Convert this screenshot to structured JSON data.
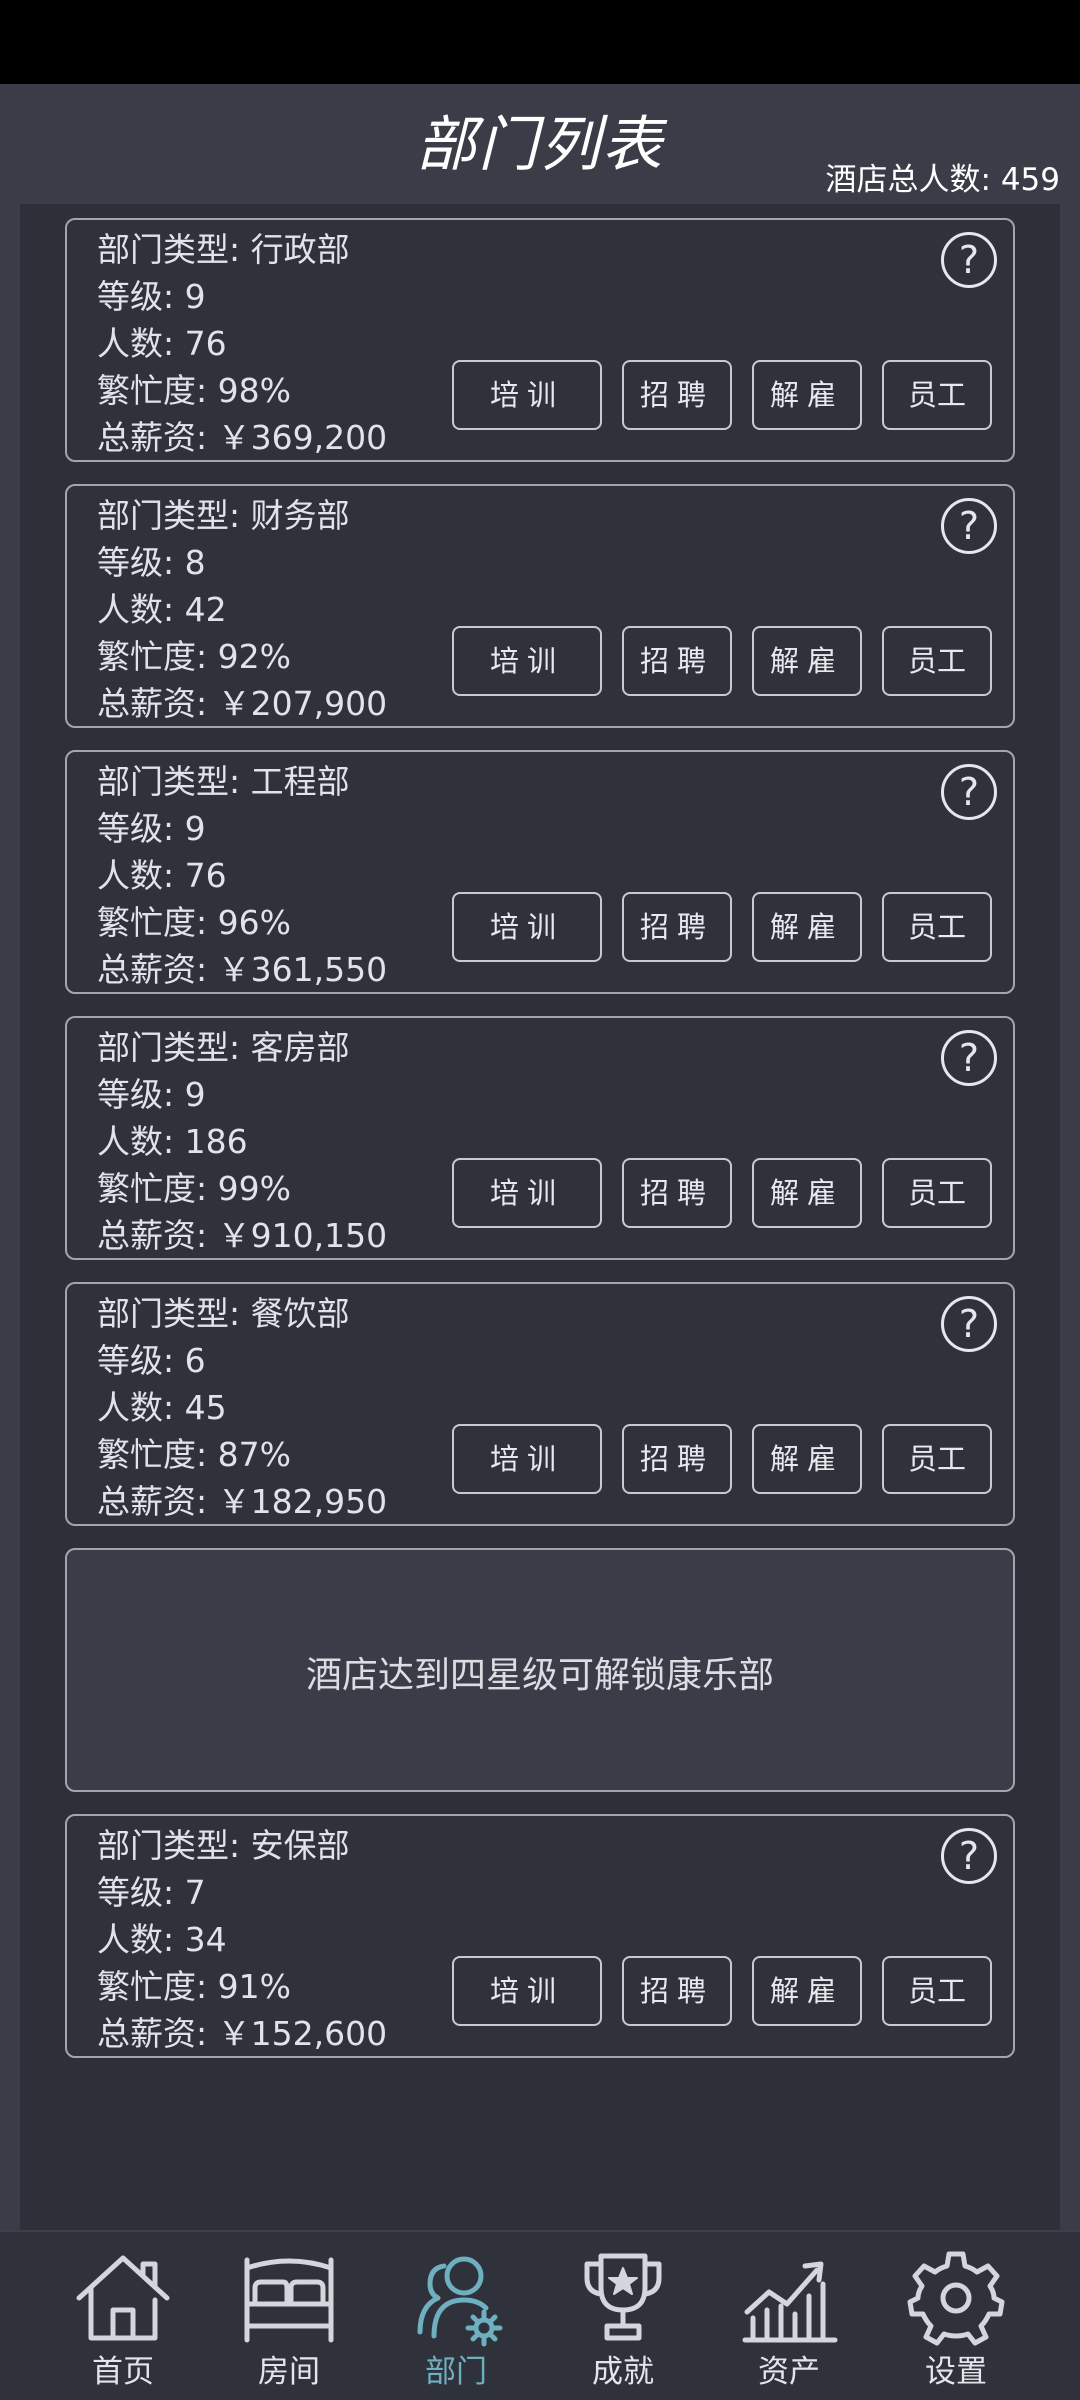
{
  "header": {
    "title": "部门列表",
    "total_staff": "酒店总人数: 459"
  },
  "departments": [
    {
      "type": "部门类型: 行政部",
      "level": "等级: 9",
      "count": "人数: 76",
      "busy": "繁忙度: 98%",
      "salary": "总薪资: ￥369,200"
    },
    {
      "type": "部门类型: 财务部",
      "level": "等级: 8",
      "count": "人数: 42",
      "busy": "繁忙度: 92%",
      "salary": "总薪资: ￥207,900"
    },
    {
      "type": "部门类型: 工程部",
      "level": "等级: 9",
      "count": "人数: 76",
      "busy": "繁忙度: 96%",
      "salary": "总薪资: ￥361,550"
    },
    {
      "type": "部门类型: 客房部",
      "level": "等级: 9",
      "count": "人数: 186",
      "busy": "繁忙度: 99%",
      "salary": "总薪资: ￥910,150"
    },
    {
      "type": "部门类型: 餐饮部",
      "level": "等级: 6",
      "count": "人数: 45",
      "busy": "繁忙度: 87%",
      "salary": "总薪资: ￥182,950"
    },
    {
      "type": "部门类型: 安保部",
      "level": "等级: 7",
      "count": "人数: 34",
      "busy": "繁忙度: 91%",
      "salary": "总薪资: ￥152,600"
    }
  ],
  "locked": {
    "text": "酒店达到四星级可解锁康乐部"
  },
  "buttons": {
    "help": "?",
    "train": "培训",
    "hire": "招聘",
    "fire": "解雇",
    "staff": "员工"
  },
  "nav": {
    "active_color": "#6fb0c0",
    "items": [
      {
        "label": "首页",
        "icon": "home-icon"
      },
      {
        "label": "房间",
        "icon": "bed-icon"
      },
      {
        "label": "部门",
        "icon": "department-icon"
      },
      {
        "label": "成就",
        "icon": "trophy-icon"
      },
      {
        "label": "资产",
        "icon": "chart-icon"
      },
      {
        "label": "设置",
        "icon": "gear-icon"
      }
    ]
  }
}
